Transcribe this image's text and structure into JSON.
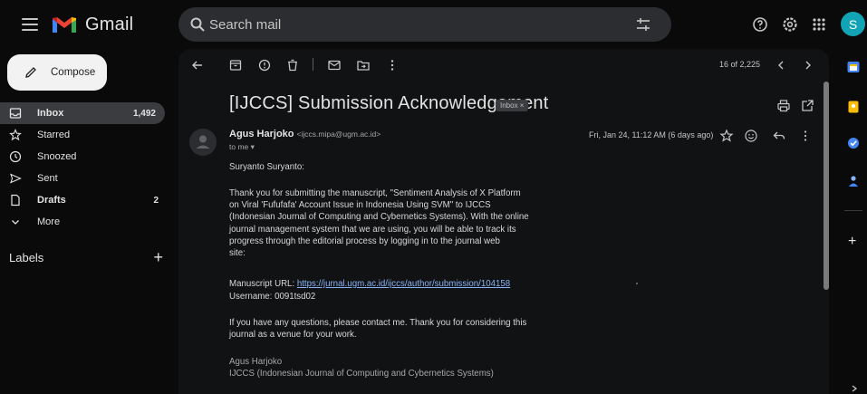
{
  "app": {
    "logo_text": "Gmail",
    "avatar_letter": "S",
    "accent": "#12a4b5"
  },
  "search": {
    "placeholder": "Search mail"
  },
  "compose": {
    "label": "Compose"
  },
  "nav": {
    "items": [
      {
        "label": "Inbox",
        "count": "1,492",
        "icon": "inbox-icon",
        "active": true
      },
      {
        "label": "Starred",
        "count": "",
        "icon": "star-icon"
      },
      {
        "label": "Snoozed",
        "count": "",
        "icon": "clock-icon"
      },
      {
        "label": "Sent",
        "count": "",
        "icon": "send-icon"
      },
      {
        "label": "Drafts",
        "count": "2",
        "icon": "file-icon"
      },
      {
        "label": "More",
        "count": "",
        "icon": "chevron-down-icon"
      }
    ],
    "labels_title": "Labels",
    "labels_add": "+"
  },
  "toolbar": {
    "count": "16 of 2,225"
  },
  "email": {
    "subject": "[IJCCS] Submission Acknowledgement",
    "badge": "Inbox ×",
    "sender_name": "Agus Harjoko",
    "sender_email": "<ijccs.mipa@ugm.ac.id>",
    "to": "to me ▾",
    "date": "Fri, Jan 24, 11:12 AM (6 days ago)",
    "greeting": "Suryanto Suryanto:",
    "paragraph1_lines": [
      "Thank you for submitting the manuscript, \"Sentiment Analysis of X Platform",
      "on Viral 'Fufufafa' Account Issue in Indonesia Using SVM\" to IJCCS",
      "(Indonesian Journal of Computing and Cybernetics Systems). With the online",
      "journal management system that we are using, you will be able to track its",
      "progress through the editorial process by logging in to the journal web",
      "site:"
    ],
    "manuscript_label": "Manuscript URL: ",
    "manuscript_url": "https://jurnal.ugm.ac.id/ijccs/author/submission/104158",
    "username": "Username: 0091tsd02",
    "paragraph2_lines": [
      "If you have any questions, please contact me. Thank you for considering this",
      "journal as a venue for your work."
    ],
    "signature_lines": [
      "Agus Harjoko",
      "IJCCS (Indonesian Journal of Computing and Cybernetics Systems)"
    ]
  }
}
